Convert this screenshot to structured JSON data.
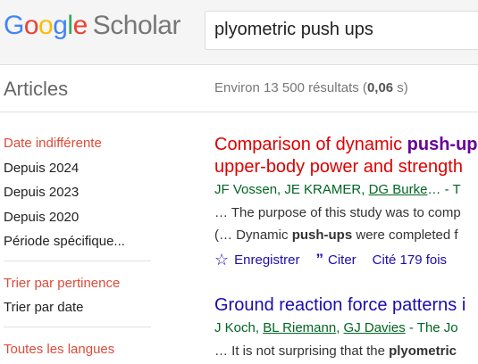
{
  "logo": {
    "letters": [
      "G",
      "o",
      "o",
      "g",
      "l",
      "e"
    ],
    "product": "Scholar"
  },
  "search": {
    "query": "plyometric push ups"
  },
  "subbar": {
    "section": "Articles",
    "results_prefix": "Environ 13 500 résultats (",
    "results_time": "0,06",
    "results_suffix": " s)"
  },
  "sidebar": {
    "date_items": [
      "Date indifférente",
      "Depuis 2024",
      "Depuis 2023",
      "Depuis 2020",
      "Période spécifique..."
    ],
    "sort_items": [
      "Trier par pertinence",
      "Trier par date"
    ],
    "language_item": "Toutes les langues"
  },
  "results": [
    {
      "title_pre": "Comparison of dynamic ",
      "title_hl": "push-up",
      "title_line2": "upper-body power and strength",
      "authors_pre": "JF Vossen, JE KRAMER, ",
      "authors_link": "DG Burke",
      "authors_post": "… - T",
      "snippet1": "… The purpose of this study was to comp",
      "snippet2_pre": "(… Dynamic ",
      "snippet2_hl": "push-ups",
      "snippet2_post": " were completed f",
      "save_label": "Enregistrer",
      "cite_label": "Citer",
      "cited_label": "Cité 179 fois"
    },
    {
      "title": "Ground reaction force patterns i",
      "authors_pre": "J Koch, ",
      "author_link1": "BL Riemann",
      "author_sep": ", ",
      "author_link2": "GJ Davies",
      "authors_post": " - The Jo",
      "snippet1_pre": "… It is not surprising that the ",
      "snippet1_hl": "plyometric"
    }
  ],
  "colors": {
    "link": "#1a0dab",
    "visited_title": "#dd0000",
    "author_green": "#006621",
    "sidebar_active": "#dd4b39"
  }
}
